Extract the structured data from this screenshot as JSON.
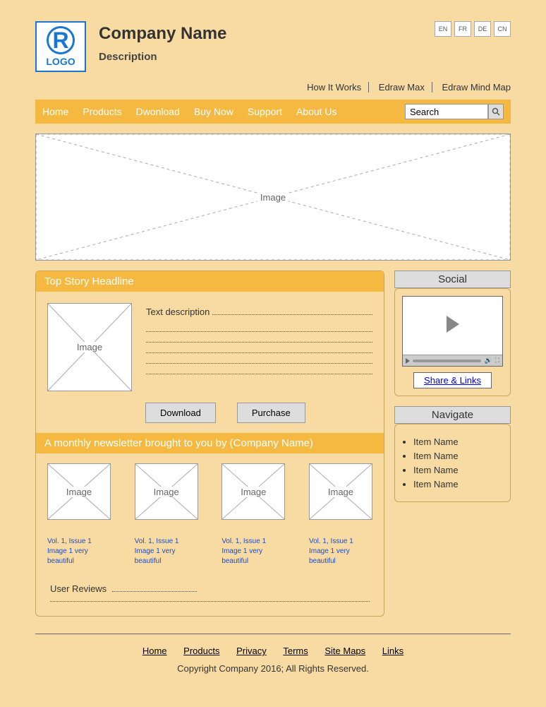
{
  "logo": {
    "text": "LOGO"
  },
  "company": {
    "name": "Company Name",
    "desc": "Description"
  },
  "languages": [
    "EN",
    "FR",
    "DE",
    "CN"
  ],
  "header_links": [
    "How It Works",
    "Edraw Max",
    "Edraw Mind Map"
  ],
  "nav": [
    "Home",
    "Products",
    "Dwonload",
    "Buy Now",
    "Support",
    "About Us"
  ],
  "search_placeholder": "Search",
  "hero_label": "Image",
  "top_story": {
    "title": "Top Story Headline",
    "image_label": "Image",
    "text": "Text description",
    "download": "Download",
    "purchase": "Purchase"
  },
  "newsletter": {
    "title": "A monthly newsletter brought to you by (Company Name)",
    "items": [
      {
        "img": "Image",
        "vol": "Vol. 1, Issue 1",
        "caption": "Image 1 very beautiful"
      },
      {
        "img": "Image",
        "vol": "Vol. 1, Issue 1",
        "caption": "Image 1 very beautiful"
      },
      {
        "img": "Image",
        "vol": "Vol. 1, Issue 1",
        "caption": "Image 1 very beautiful"
      },
      {
        "img": "Image",
        "vol": "Vol. 1, Issue 1",
        "caption": "Image 1 very beautiful"
      }
    ]
  },
  "reviews_label": "User Reviews",
  "social": {
    "title": "Social",
    "share": "Share & Links"
  },
  "navigate": {
    "title": "Navigate",
    "items": [
      "Item Name",
      "Item Name",
      "Item Name",
      "Item Name"
    ]
  },
  "footer_links": [
    "Home",
    "Products",
    "Privacy",
    "Terms",
    "Site Maps",
    "Links"
  ],
  "copyright": "Copyright Company 2016; All Rights Reserved."
}
